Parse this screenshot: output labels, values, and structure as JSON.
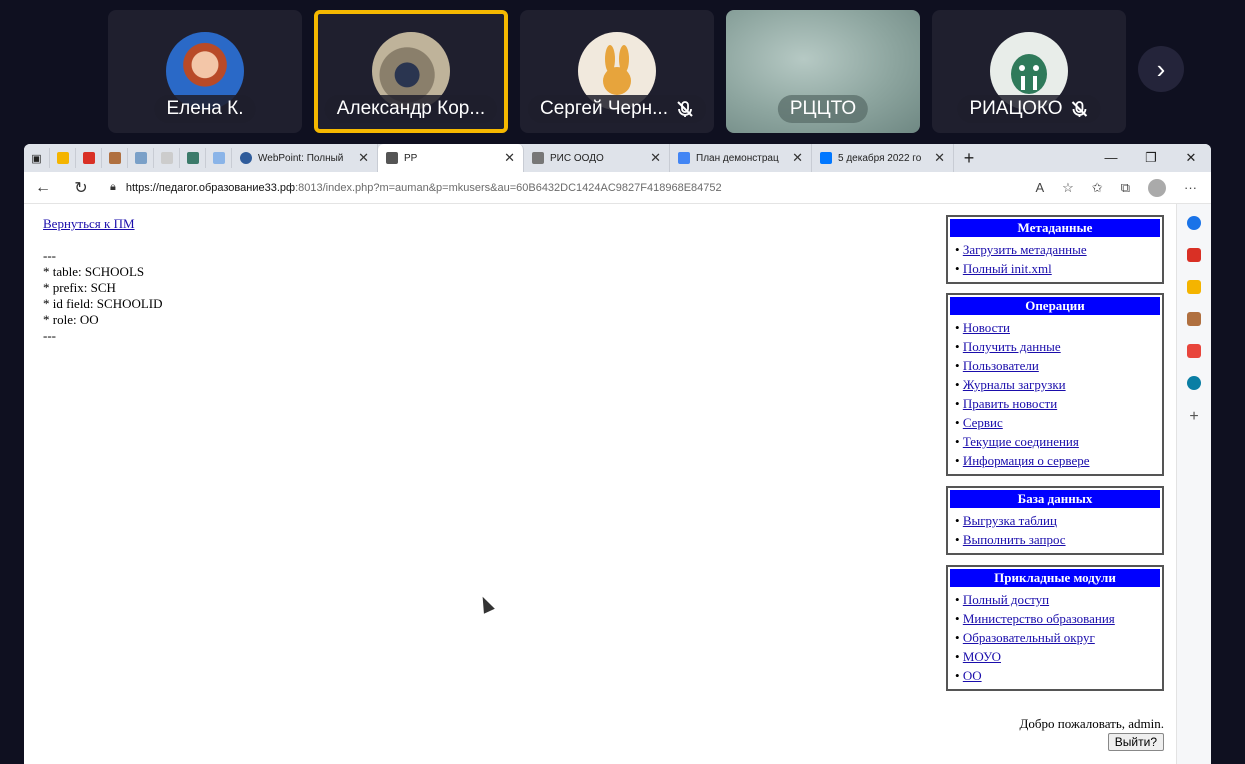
{
  "conference": {
    "participants": [
      {
        "name": "Елена К.",
        "muted": false,
        "active": false
      },
      {
        "name": "Александр Кор...",
        "muted": false,
        "active": true
      },
      {
        "name": "Сергей Черн...",
        "muted": true,
        "active": false
      },
      {
        "name": "РЦЦТО",
        "muted": false,
        "active": false
      },
      {
        "name": "РИАЦОКО",
        "muted": true,
        "active": false
      }
    ],
    "next_icon": "chevron-right-icon",
    "accent_color": "#f5b800"
  },
  "browser": {
    "tabs": [
      {
        "label": "WebPoint: Полный",
        "selected": false
      },
      {
        "label": "РР",
        "selected": true
      },
      {
        "label": "РИС ООДО",
        "selected": false
      },
      {
        "label": "План демонстрац",
        "selected": false
      },
      {
        "label": "5 декабря 2022 го",
        "selected": false
      }
    ],
    "url_host": "https://педагог.образование33.рф",
    "url_rest": ":8013/index.php?m=auman&p=mkusers&au=60B6432DC1424AC9827F418968E84752"
  },
  "page": {
    "back_link": "Вернуться к ПМ",
    "meta_lines": [
      "---",
      "* table: SCHOOLS",
      "* prefix: SCH",
      "* id field: SCHOOLID",
      "* role: OO",
      "---"
    ],
    "panels": [
      {
        "title": "Метаданные",
        "items": [
          "Загрузить метаданные",
          "Полный init.xml"
        ]
      },
      {
        "title": "Операции",
        "items": [
          "Новости",
          "Получить данные",
          "Пользователи",
          "Журналы загрузки",
          "Править новости",
          "Сервис",
          "Текущие соединения",
          "Информация о сервере"
        ]
      },
      {
        "title": "База данных",
        "items": [
          "Выгрузка таблиц",
          "Выполнить запрос"
        ]
      },
      {
        "title": "Прикладные модули",
        "items": [
          "Полный доступ",
          "Министерство образования",
          "Образовательный округ",
          "МОУО",
          "ОО"
        ]
      }
    ],
    "welcome": "Добро пожаловать, admin.",
    "logout": "Выйти?"
  }
}
